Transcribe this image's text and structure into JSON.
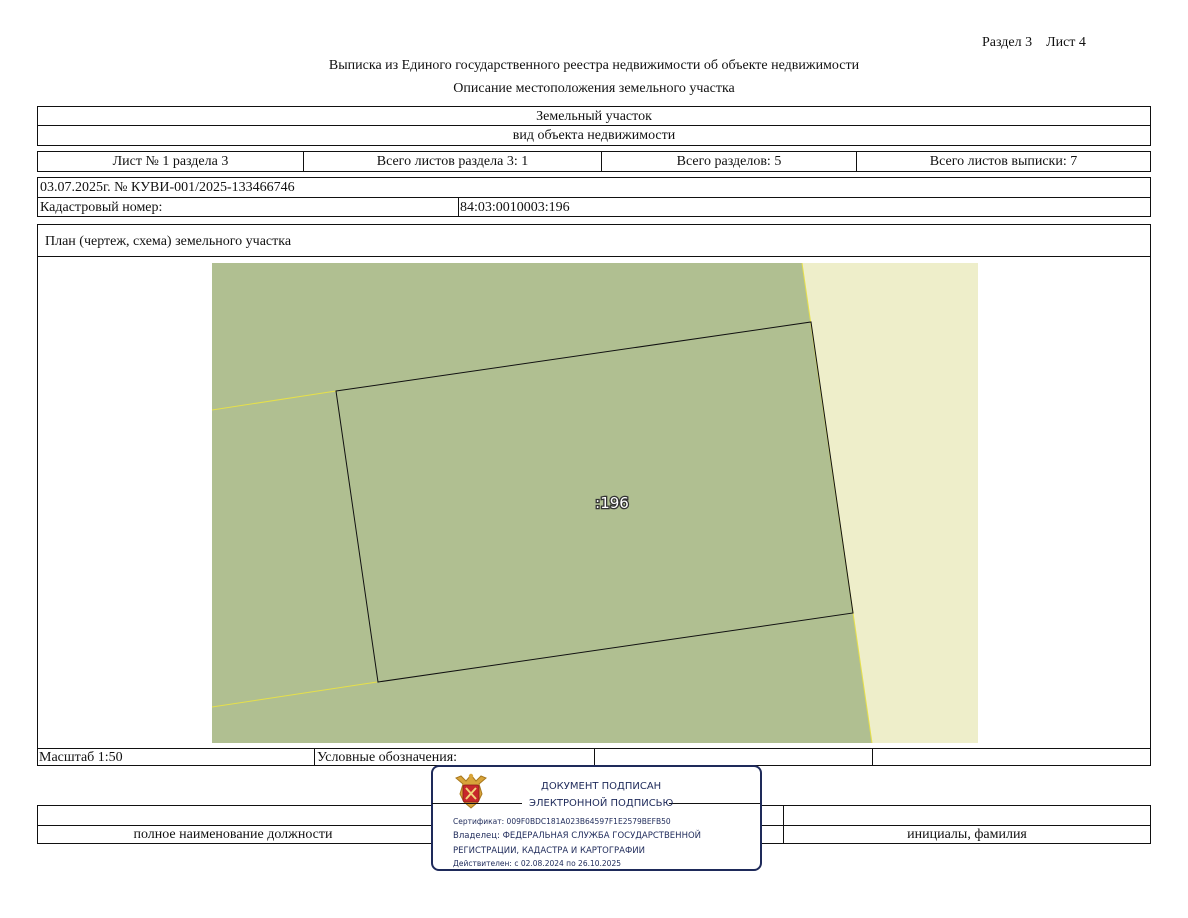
{
  "header": {
    "section_sheet": "Раздел 3    Лист 4",
    "title": "Выписка из Единого государственного реестра недвижимости об объекте недвижимости",
    "subtitle": "Описание местоположения земельного участка"
  },
  "object": {
    "type_value": "Земельный участок",
    "type_caption": "вид объекта недвижимости"
  },
  "sheet_info": {
    "sheet_no": "Лист № 1 раздела 3",
    "total_sheets_section": "Всего листов раздела 3: 1",
    "total_sections": "Всего разделов: 5",
    "total_sheets_extract": "Всего листов выписки: 7"
  },
  "record": {
    "date_number": "03.07.2025г. № КУВИ-001/2025-133466746",
    "cadastral_label": "Кадастровый номер:",
    "cadastral_value": "84:03:0010003:196"
  },
  "plan": {
    "title": "План (чертеж, схема) земельного участка",
    "parcel_label": ":196",
    "colors": {
      "land": "#b0bf91",
      "adjacent": "#eeeeca",
      "boundary_yellow": "#e6e04a"
    }
  },
  "footer": {
    "scale": "Масштаб 1:50",
    "legend_label": "Условные обозначения:",
    "position_caption": "полное наименование должности",
    "name_caption": "инициалы, фамилия"
  },
  "stamp": {
    "emblem_icon": "coat-of-arms-icon",
    "line1": "ДОКУМЕНТ ПОДПИСАН",
    "line2": "ЭЛЕКТРОННОЙ ПОДПИСЬЮ",
    "certificate": "Сертификат: 009F0BDC181A023B64597F1E2579BEFB50",
    "owner1": "Владелец: ФЕДЕРАЛЬНАЯ СЛУЖБА ГОСУДАРСТВЕННОЙ",
    "owner2": "РЕГИСТРАЦИИ, КАДАСТРА И КАРТОГРАФИИ",
    "valid": "Действителен: с 02.08.2024 по 26.10.2025",
    "color": "#1e2a5a"
  }
}
